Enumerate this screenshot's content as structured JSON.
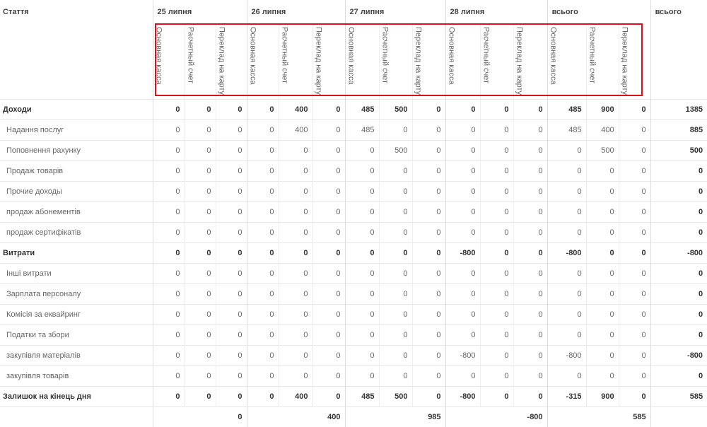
{
  "header": {
    "article_label": "Стаття",
    "dates": [
      "25 липня",
      "26 липня",
      "27 липня",
      "28 липня",
      "всього"
    ],
    "grand_total_label": "всього",
    "accounts": [
      "Основная касса",
      "Расчетный счет",
      "Переклад на карту"
    ]
  },
  "rows": [
    {
      "label": "Доходи",
      "bold": true,
      "values": [
        "0",
        "0",
        "0",
        "0",
        "400",
        "0",
        "485",
        "500",
        "0",
        "0",
        "0",
        "0",
        "485",
        "900",
        "0"
      ],
      "total": "1385"
    },
    {
      "label": "Надання послуг",
      "bold": false,
      "values": [
        "0",
        "0",
        "0",
        "0",
        "400",
        "0",
        "485",
        "0",
        "0",
        "0",
        "0",
        "0",
        "485",
        "400",
        "0"
      ],
      "total": "885"
    },
    {
      "label": "Поповнення рахунку",
      "bold": false,
      "values": [
        "0",
        "0",
        "0",
        "0",
        "0",
        "0",
        "0",
        "500",
        "0",
        "0",
        "0",
        "0",
        "0",
        "500",
        "0"
      ],
      "total": "500"
    },
    {
      "label": "Продаж товарів",
      "bold": false,
      "values": [
        "0",
        "0",
        "0",
        "0",
        "0",
        "0",
        "0",
        "0",
        "0",
        "0",
        "0",
        "0",
        "0",
        "0",
        "0"
      ],
      "total": "0"
    },
    {
      "label": "Прочие доходы",
      "bold": false,
      "values": [
        "0",
        "0",
        "0",
        "0",
        "0",
        "0",
        "0",
        "0",
        "0",
        "0",
        "0",
        "0",
        "0",
        "0",
        "0"
      ],
      "total": "0"
    },
    {
      "label": "продаж абонементів",
      "bold": false,
      "values": [
        "0",
        "0",
        "0",
        "0",
        "0",
        "0",
        "0",
        "0",
        "0",
        "0",
        "0",
        "0",
        "0",
        "0",
        "0"
      ],
      "total": "0"
    },
    {
      "label": "продаж сертифікатів",
      "bold": false,
      "values": [
        "0",
        "0",
        "0",
        "0",
        "0",
        "0",
        "0",
        "0",
        "0",
        "0",
        "0",
        "0",
        "0",
        "0",
        "0"
      ],
      "total": "0"
    },
    {
      "label": "Витрати",
      "bold": true,
      "values": [
        "0",
        "0",
        "0",
        "0",
        "0",
        "0",
        "0",
        "0",
        "0",
        "-800",
        "0",
        "0",
        "-800",
        "0",
        "0"
      ],
      "total": "-800"
    },
    {
      "label": "Інші витрати",
      "bold": false,
      "values": [
        "0",
        "0",
        "0",
        "0",
        "0",
        "0",
        "0",
        "0",
        "0",
        "0",
        "0",
        "0",
        "0",
        "0",
        "0"
      ],
      "total": "0"
    },
    {
      "label": "Зарплата персоналу",
      "bold": false,
      "values": [
        "0",
        "0",
        "0",
        "0",
        "0",
        "0",
        "0",
        "0",
        "0",
        "0",
        "0",
        "0",
        "0",
        "0",
        "0"
      ],
      "total": "0"
    },
    {
      "label": "Комісія за еквайринг",
      "bold": false,
      "values": [
        "0",
        "0",
        "0",
        "0",
        "0",
        "0",
        "0",
        "0",
        "0",
        "0",
        "0",
        "0",
        "0",
        "0",
        "0"
      ],
      "total": "0"
    },
    {
      "label": "Податки та збори",
      "bold": false,
      "values": [
        "0",
        "0",
        "0",
        "0",
        "0",
        "0",
        "0",
        "0",
        "0",
        "0",
        "0",
        "0",
        "0",
        "0",
        "0"
      ],
      "total": "0"
    },
    {
      "label": "закупівля матеріалів",
      "bold": false,
      "values": [
        "0",
        "0",
        "0",
        "0",
        "0",
        "0",
        "0",
        "0",
        "0",
        "-800",
        "0",
        "0",
        "-800",
        "0",
        "0"
      ],
      "total": "-800"
    },
    {
      "label": "закупівля товарів",
      "bold": false,
      "values": [
        "0",
        "0",
        "0",
        "0",
        "0",
        "0",
        "0",
        "0",
        "0",
        "0",
        "0",
        "0",
        "0",
        "0",
        "0"
      ],
      "total": "0"
    },
    {
      "label": "Залишок на кінець дня",
      "bold": true,
      "values": [
        "0",
        "0",
        "0",
        "0",
        "400",
        "0",
        "485",
        "500",
        "0",
        "-800",
        "0",
        "0",
        "-315",
        "900",
        "0"
      ],
      "total": "585"
    }
  ],
  "footer": [
    "0",
    "400",
    "985",
    "-800",
    "585"
  ],
  "colors": {
    "highlight_border": "#e0101a",
    "grid_line": "#e6e6e6"
  }
}
